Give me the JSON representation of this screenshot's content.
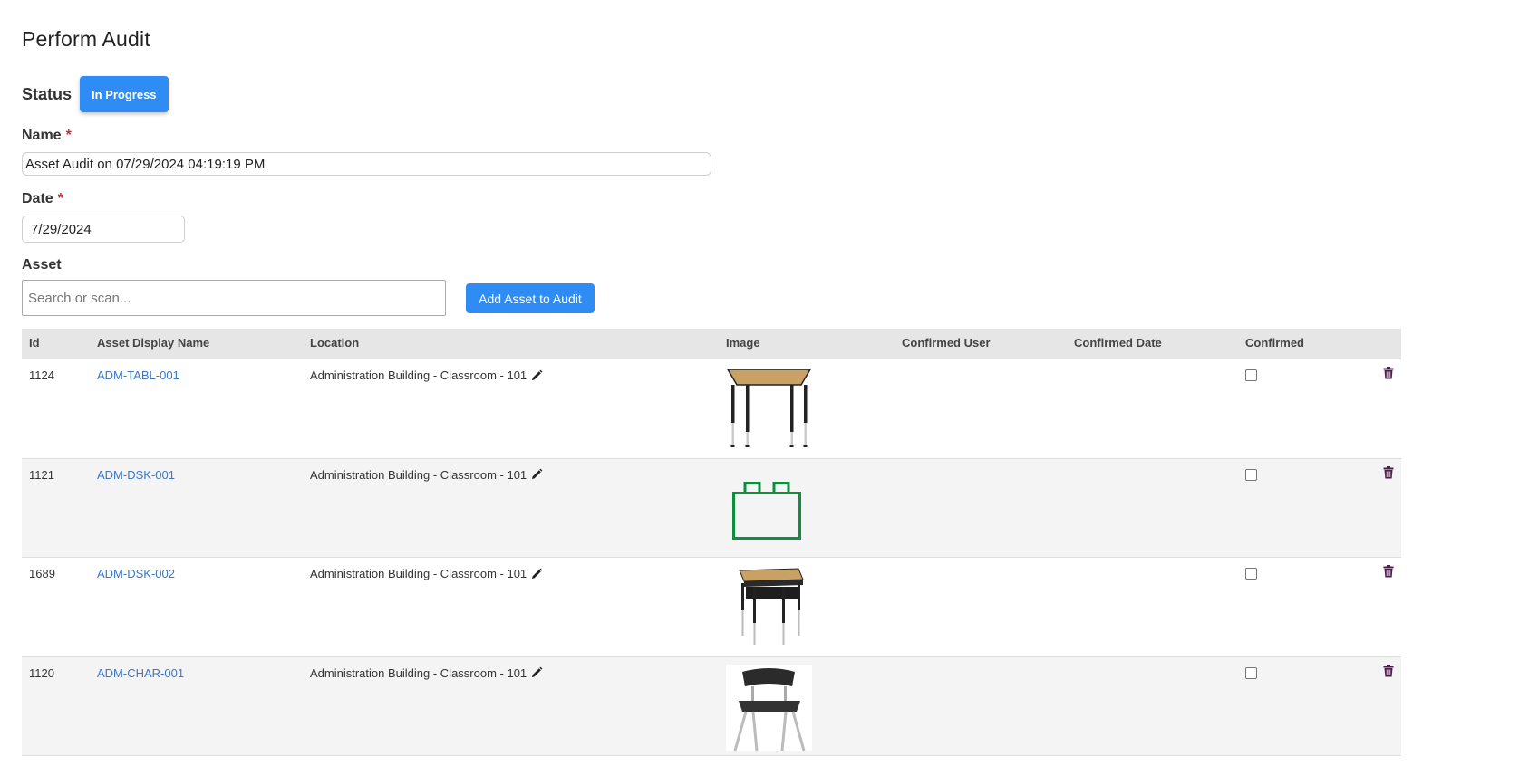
{
  "page": {
    "title": "Perform Audit"
  },
  "status": {
    "label": "Status",
    "value": "In Progress",
    "color": "#2f8cf4"
  },
  "form": {
    "name_label": "Name",
    "name_value": "Asset Audit on 07/29/2024 04:19:19 PM",
    "date_label": "Date",
    "date_value": "7/29/2024",
    "required_mark": "*",
    "asset_label": "Asset",
    "asset_placeholder": "Search or scan...",
    "add_button": "Add Asset to Audit"
  },
  "table": {
    "columns": [
      "Id",
      "Asset Display Name",
      "Location",
      "Image",
      "Confirmed User",
      "Confirmed Date",
      "Confirmed"
    ],
    "rows": [
      {
        "id": "1124",
        "name": "ADM-TABL-001",
        "location": "Administration Building - Classroom - 101",
        "image": "trapezoid-table-image",
        "confirmed_user": "",
        "confirmed_date": "",
        "confirmed": false
      },
      {
        "id": "1121",
        "name": "ADM-DSK-001",
        "location": "Administration Building - Classroom - 101",
        "image": "placeholder-asset-icon",
        "confirmed_user": "",
        "confirmed_date": "",
        "confirmed": false
      },
      {
        "id": "1689",
        "name": "ADM-DSK-002",
        "location": "Administration Building - Classroom - 101",
        "image": "student-desk-image",
        "confirmed_user": "",
        "confirmed_date": "",
        "confirmed": false
      },
      {
        "id": "1120",
        "name": "ADM-CHAR-001",
        "location": "Administration Building - Classroom - 101",
        "image": "chair-image",
        "confirmed_user": "",
        "confirmed_date": "",
        "confirmed": false
      }
    ]
  },
  "icons": {
    "calendar": "calendar-icon",
    "edit": "pencil-icon",
    "delete": "trash-icon"
  },
  "colors": {
    "accent": "#2f8cf4",
    "link": "#3a77c9",
    "required": "#e0282e",
    "placeholder_icon": "#0e8f3e",
    "trash": "#4a1f4a"
  }
}
